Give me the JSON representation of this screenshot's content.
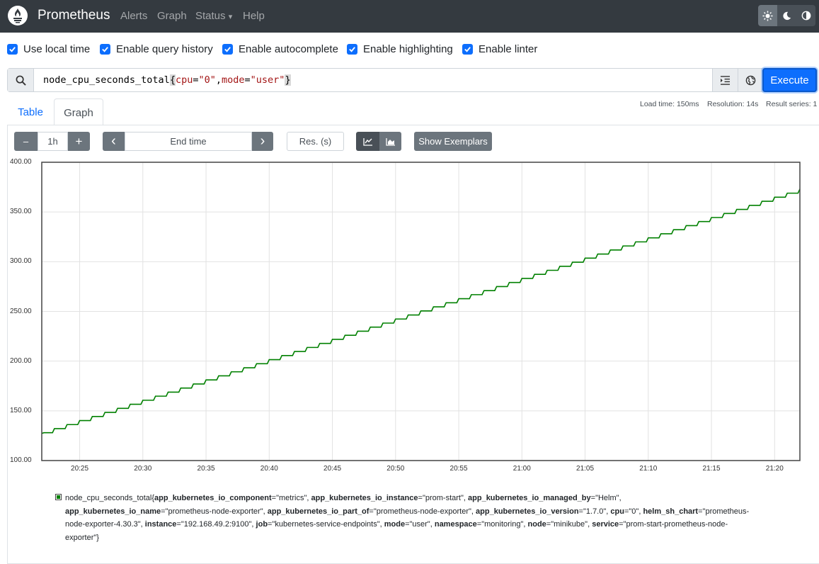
{
  "navbar": {
    "brand": "Prometheus",
    "links": [
      "Alerts",
      "Graph",
      "Status",
      "Help"
    ],
    "status_caret": "▾",
    "theme_icons": [
      "sun-icon",
      "moon-icon",
      "half-circle-icon"
    ]
  },
  "options": [
    {
      "label": "Use local time",
      "checked": true
    },
    {
      "label": "Enable query history",
      "checked": true
    },
    {
      "label": "Enable autocomplete",
      "checked": true
    },
    {
      "label": "Enable highlighting",
      "checked": true
    },
    {
      "label": "Enable linter",
      "checked": true
    }
  ],
  "query": {
    "metric": "node_cpu_seconds_total",
    "open_brace": "{",
    "label1_key": "cpu",
    "label1_val": "\"0\"",
    "comma": ",",
    "label2_key": "mode",
    "label2_val": "\"user\"",
    "close_brace": "}",
    "eq": "="
  },
  "execute_label": "Execute",
  "tabs": {
    "table": "Table",
    "graph": "Graph",
    "active": "Graph"
  },
  "stats": {
    "load_time": "Load time: 150ms",
    "resolution": "Resolution: 14s",
    "result_series": "Result series: 1"
  },
  "controls": {
    "minus": "–",
    "range": "1h",
    "plus": "+",
    "prev": "‹",
    "end_time_placeholder": "End time",
    "next": "›",
    "res_placeholder": "Res. (s)",
    "show_exemplars": "Show Exemplars"
  },
  "colors": {
    "accent": "#0d6efd",
    "series": "#008000",
    "navbar": "#343a40"
  },
  "chart_data": {
    "type": "line",
    "ylim": [
      100,
      400
    ],
    "yticks": [
      "400.00",
      "350.00",
      "300.00",
      "250.00",
      "200.00",
      "150.00",
      "100.00"
    ],
    "xticks": [
      "20:25",
      "20:30",
      "20:35",
      "20:40",
      "20:45",
      "20:50",
      "20:55",
      "21:00",
      "21:05",
      "21:10",
      "21:15",
      "21:20"
    ],
    "xlim_minutes": [
      "20:22",
      "21:22"
    ],
    "grid": true,
    "series": [
      {
        "start_value": 128,
        "end_value": 373,
        "shape": "staircase, rising steadily",
        "steps": 60
      }
    ]
  },
  "legend": {
    "metric": "node_cpu_seconds_total",
    "labels": [
      {
        "k": "app_kubernetes_io_component",
        "v": "\"metrics\""
      },
      {
        "k": "app_kubernetes_io_instance",
        "v": "\"prom-start\""
      },
      {
        "k": "app_kubernetes_io_managed_by",
        "v": "\"Helm\""
      },
      {
        "k": "app_kubernetes_io_name",
        "v": "\"prometheus-node-exporter\""
      },
      {
        "k": "app_kubernetes_io_part_of",
        "v": "\"prometheus-node-exporter\""
      },
      {
        "k": "app_kubernetes_io_version",
        "v": "\"1.7.0\""
      },
      {
        "k": "cpu",
        "v": "\"0\""
      },
      {
        "k": "helm_sh_chart",
        "v": "\"prometheus-node-exporter-4.30.3\""
      },
      {
        "k": "instance",
        "v": "\"192.168.49.2:9100\""
      },
      {
        "k": "job",
        "v": "\"kubernetes-service-endpoints\""
      },
      {
        "k": "mode",
        "v": "\"user\""
      },
      {
        "k": "namespace",
        "v": "\"monitoring\""
      },
      {
        "k": "node",
        "v": "\"minikube\""
      },
      {
        "k": "service",
        "v": "\"prom-start-prometheus-node-exporter\""
      }
    ]
  }
}
